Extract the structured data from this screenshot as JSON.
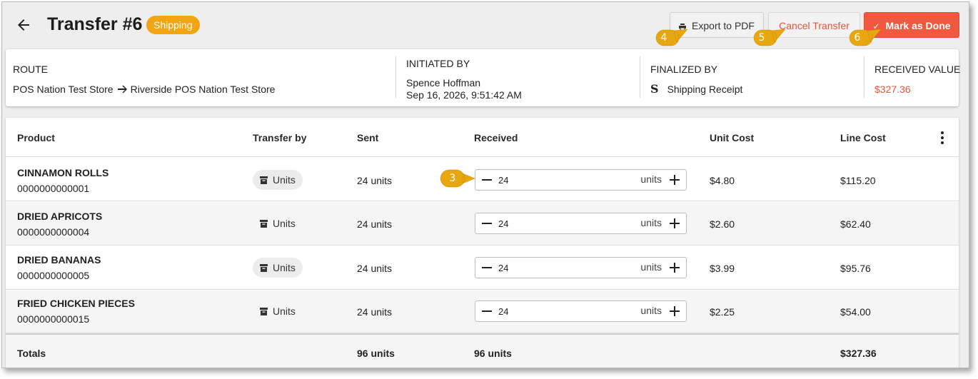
{
  "header": {
    "title": "Transfer #6",
    "status_badge": "Shipping",
    "export_label": "Export to PDF",
    "cancel_label": "Cancel Transfer",
    "done_label": "Mark as Done"
  },
  "callouts": {
    "export": "4",
    "cancel": "5",
    "done": "6",
    "received": "3"
  },
  "info": {
    "route_label": "ROUTE",
    "route_from": "POS Nation Test Store",
    "route_to": "Riverside POS Nation Test Store",
    "initiated_label": "INITIATED BY",
    "initiated_name": "Spence Hoffman",
    "initiated_date": "Sep 16, 2026, 9:51:42 AM",
    "finalized_label": "FINALIZED BY",
    "finalized_mark": "S",
    "finalized_value": "Shipping Receipt",
    "received_value_label": "RECEIVED VALUE",
    "received_value": "$327.36"
  },
  "table": {
    "columns": [
      "Product",
      "Transfer by",
      "Sent",
      "Received",
      "Unit Cost",
      "Line Cost"
    ],
    "rows": [
      {
        "name": "CINNAMON ROLLS",
        "sku": "0000000000001",
        "transfer_by": "Units",
        "sent": "24 units",
        "received": "24",
        "received_unit": "units",
        "unit_cost": "$4.80",
        "line_cost": "$115.20"
      },
      {
        "name": "DRIED APRICOTS",
        "sku": "0000000000004",
        "transfer_by": "Units",
        "sent": "24 units",
        "received": "24",
        "received_unit": "units",
        "unit_cost": "$2.60",
        "line_cost": "$62.40"
      },
      {
        "name": "DRIED BANANAS",
        "sku": "0000000000005",
        "transfer_by": "Units",
        "sent": "24 units",
        "received": "24",
        "received_unit": "units",
        "unit_cost": "$3.99",
        "line_cost": "$95.76"
      },
      {
        "name": "FRIED CHICKEN PIECES",
        "sku": "0000000000015",
        "transfer_by": "Units",
        "sent": "24 units",
        "received": "24",
        "received_unit": "units",
        "unit_cost": "$2.25",
        "line_cost": "$54.00"
      }
    ],
    "totals": {
      "label": "Totals",
      "sent": "96 units",
      "received": "96 units",
      "line_cost": "$327.36"
    }
  },
  "colors": {
    "accent": "#f0583f",
    "badge": "#f3a412",
    "callout": "#e9a70f"
  },
  "icons": [
    "back-arrow-icon",
    "printer-icon",
    "check-icon",
    "arrow-right-icon",
    "box-icon",
    "minus-icon",
    "plus-icon",
    "kebab-menu-icon"
  ]
}
